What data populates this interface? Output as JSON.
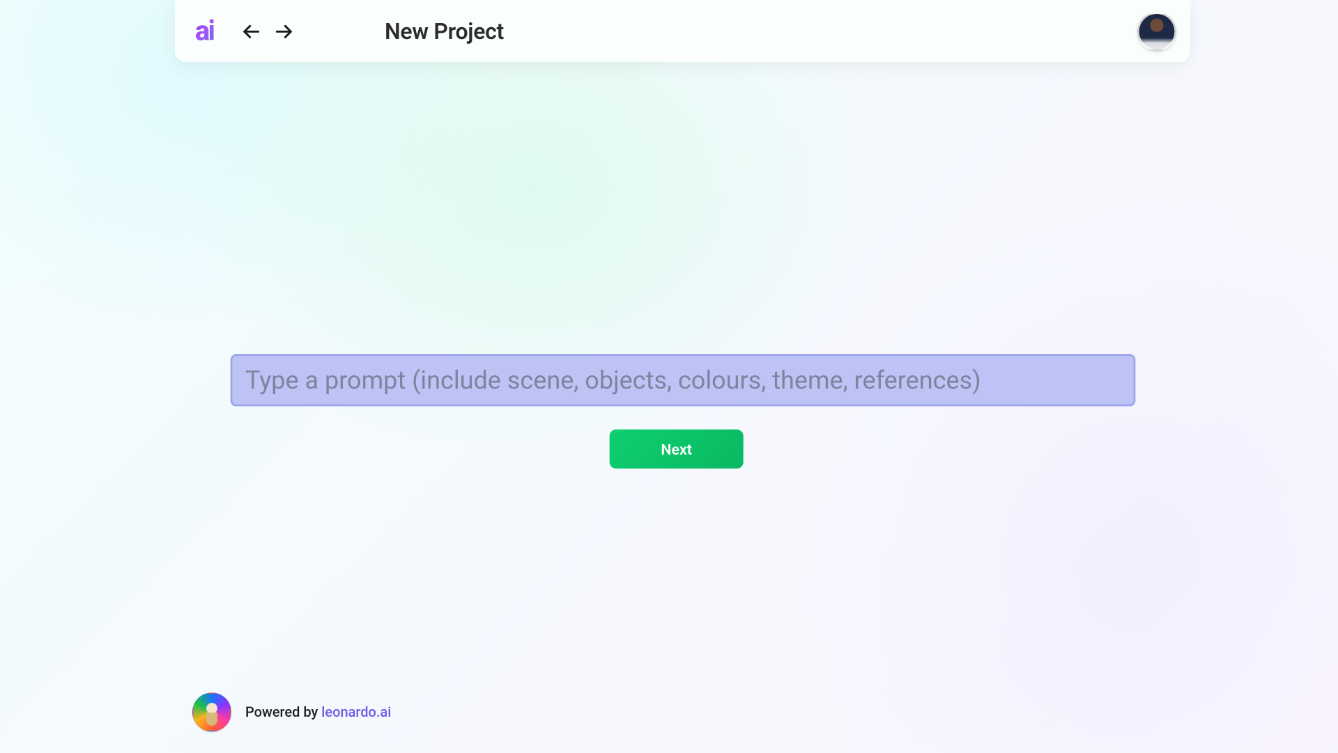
{
  "header": {
    "logo_text": "ai",
    "title": "New Project"
  },
  "main": {
    "prompt_placeholder": "Type a prompt (include scene, objects, colours, theme, references)",
    "prompt_value": "",
    "next_label": "Next"
  },
  "footer": {
    "prefix": "Powered by ",
    "link_text": "leonardo.ai"
  }
}
